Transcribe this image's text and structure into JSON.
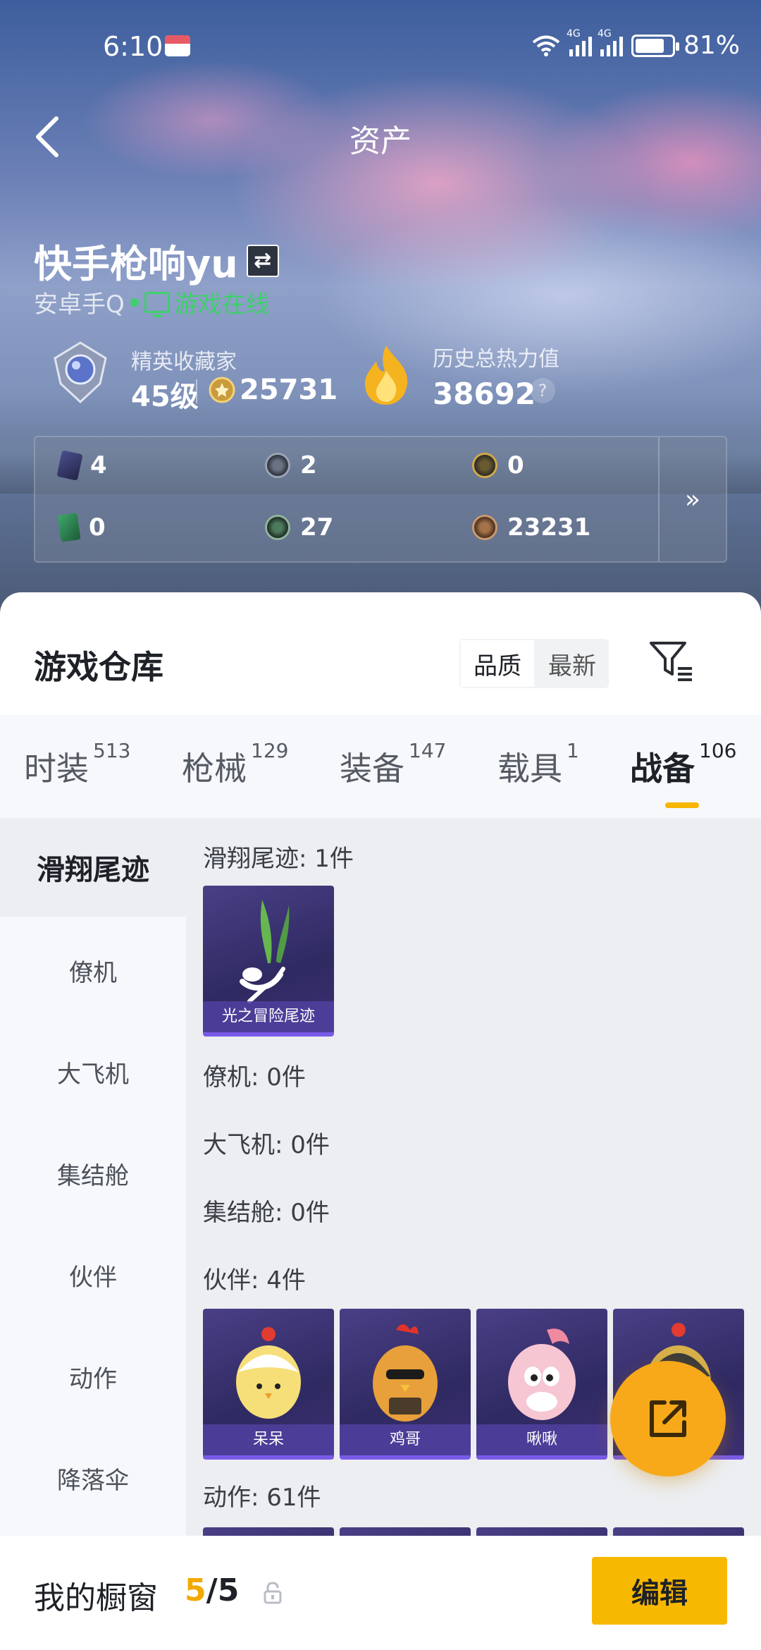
{
  "status_bar": {
    "time": "6:10",
    "signal_1": "4G",
    "signal_2": "4G",
    "battery": "81%"
  },
  "header": {
    "title": "资产"
  },
  "profile": {
    "name": "快手枪响yu",
    "platform": "安卓手Q",
    "online_status": "游戏在线",
    "rank_label": "精英收藏家",
    "rank_level": "45级",
    "coins": "25731",
    "heat_label": "历史总热力值",
    "heat_value": "38692",
    "help": "?"
  },
  "stats": [
    "4",
    "2",
    "0",
    "0",
    "27",
    "23231"
  ],
  "stats_more": "»",
  "warehouse": {
    "title": "游戏仓库",
    "sort_options": [
      "品质",
      "最新"
    ],
    "sort_selected": "品质"
  },
  "tabs": [
    {
      "label": "时装",
      "count": "513"
    },
    {
      "label": "枪械",
      "count": "129"
    },
    {
      "label": "装备",
      "count": "147"
    },
    {
      "label": "载具",
      "count": "1"
    },
    {
      "label": "战备",
      "count": "106"
    }
  ],
  "active_tab": "战备",
  "sidebar": [
    "滑翔尾迹",
    "僚机",
    "大飞机",
    "集结舱",
    "伙伴",
    "动作",
    "降落伞"
  ],
  "sidebar_active": "滑翔尾迹",
  "sections": {
    "glide": {
      "label": "滑翔尾迹: 1件",
      "items": [
        "光之冒险尾迹"
      ]
    },
    "wingman": {
      "label": "僚机: 0件"
    },
    "plane": {
      "label": "大飞机: 0件"
    },
    "pod": {
      "label": "集结舱: 0件"
    },
    "partner": {
      "label": "伙伴: 4件",
      "items": [
        "呆呆",
        "鸡哥",
        "啾啾"
      ]
    },
    "emote": {
      "label": "动作: 61件"
    }
  },
  "bottom_bar": {
    "label": "我的橱窗",
    "count_current": "5",
    "count_total": "/5",
    "edit_label": "编辑"
  },
  "colors": {
    "accent": "#f7b800",
    "online": "#3fcf6d",
    "card": "#3b2f70"
  }
}
